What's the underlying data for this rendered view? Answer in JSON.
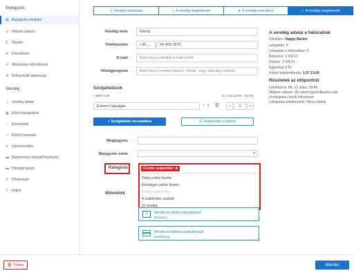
{
  "sidebar": {
    "group_bejegyzes": "Bejegyzés",
    "group_vendeg": "Vendég",
    "items": [
      {
        "label": "Bejegyzés részletei",
        "icon": "document-icon"
      },
      {
        "label": "Időpont státusz",
        "icon": "clock-icon"
      },
      {
        "label": "Fizetés",
        "icon": "dollar-icon"
      },
      {
        "label": "Értesítések",
        "icon": "mail-icon"
      },
      {
        "label": "Módosítási előzmények",
        "icon": "history-icon"
      },
      {
        "label": "Felhasznált alapanyag",
        "icon": "tools-icon"
      },
      {
        "label": "Vendég adatai",
        "icon": "user-icon"
      },
      {
        "label": "Előző látogatások",
        "icon": "calendar-icon"
      },
      {
        "label": "Elemzések",
        "icon": "chart-icon"
      },
      {
        "label": "Előző Üzenetek",
        "icon": "message-icon"
      },
      {
        "label": "Üzenet küldés",
        "icon": "send-icon"
      },
      {
        "label": "Elektronikus kártya(Passbook)",
        "icon": "card-icon"
      },
      {
        "label": "Hűségprogram",
        "icon": "card-icon"
      },
      {
        "label": "Hívásnapló",
        "icon": "phone-icon"
      },
      {
        "label": "Fájlok",
        "icon": "paperclip-icon"
      }
    ]
  },
  "tabs": [
    {
      "label": "Vendég várakozás",
      "icon": "clock-icon"
    },
    {
      "label": "A vendég megérkezett",
      "icon": "check-circle-icon"
    },
    {
      "label": "A vendég nem jött el",
      "icon": "x-circle-icon"
    },
    {
      "label": "A vendég megérkezett",
      "icon": "check-circle-icon"
    }
  ],
  "form": {
    "name_label": "Vendég neve",
    "name_value": "Károly",
    "phone_label": "Telefonszám",
    "phone_prefix": "+36",
    "phone_value": "34 456 7875",
    "email_label": "E-mail",
    "email_placeholder": "Add meg a vendég e-mail címét",
    "loyalty_label": "Hűségprogram",
    "loyalty_placeholder": "Add meg a vendég kártya-, bérlet- vagy utalvány számát"
  },
  "info": {
    "title": "A vendég adatai a hálózatnál",
    "lines": [
      {
        "label": "Üzletlánc:",
        "value": "Happy Barber"
      },
      {
        "label": "Látogatás:",
        "value": "6"
      },
      {
        "label": "Látogatás a hálózatban:",
        "value": "6"
      },
      {
        "label": "Befizetve:",
        "value": "3 500 Ft"
      },
      {
        "label": "Fizetve:",
        "value": "3 500 Ft"
      },
      {
        "label": "Egyenleg:",
        "value": "0 Ft"
      },
      {
        "label": "Utolsó bejelentkezés:",
        "value": "1.07 13:00"
      }
    ],
    "appointment_title": "Részletek az időpontról",
    "appointment_lines": [
      "Létrehozva: Hé, 01 július, 09:49",
      "Időpont státusz : Az adott bejelentkezés csak",
      "részlegesen került lefizetésre",
      "Látogatási emlékeztető: Nincs küldve"
    ]
  },
  "services": {
    "label": "Szolgáltatások",
    "price": "3500 HUF",
    "time": "1 óra (13:00 - 14:00)",
    "selected": "Extrem Hajvágás",
    "quantity": "1",
    "add_service_button": "Szolgáltatás hozzáadása",
    "select_from_list_button": "Kiválasztás a listából"
  },
  "notes": {
    "label": "Megjegyzés",
    "color_label": "Bejegyzés színe"
  },
  "category": {
    "label": "Kategória",
    "selected_tag": "Fizetés szakember",
    "options": [
      {
        "label": "Teljes online fizetés",
        "disabled": false
      },
      {
        "label": "Részleges online fizetés",
        "disabled": false
      },
      {
        "label": "Fizetés szakember",
        "disabled": true
      },
      {
        "label": "A szakember szabad",
        "disabled": false
      },
      {
        "label": "Új vendég",
        "disabled": false
      }
    ]
  },
  "actions": {
    "label": "Műveletek",
    "payment1_title": "Mentés és fizetés készpénzzel",
    "payment1_sub": "Recepció",
    "payment2_title": "Mentés és fizetés bankkártyával",
    "payment2_sub": "Bankkártya"
  },
  "footer": {
    "delete_label": "Törlés",
    "save_label": "Mentés"
  },
  "colors": {
    "accent": "#1a73c8",
    "highlight": "#d32020",
    "teal": "#1aa69a"
  }
}
